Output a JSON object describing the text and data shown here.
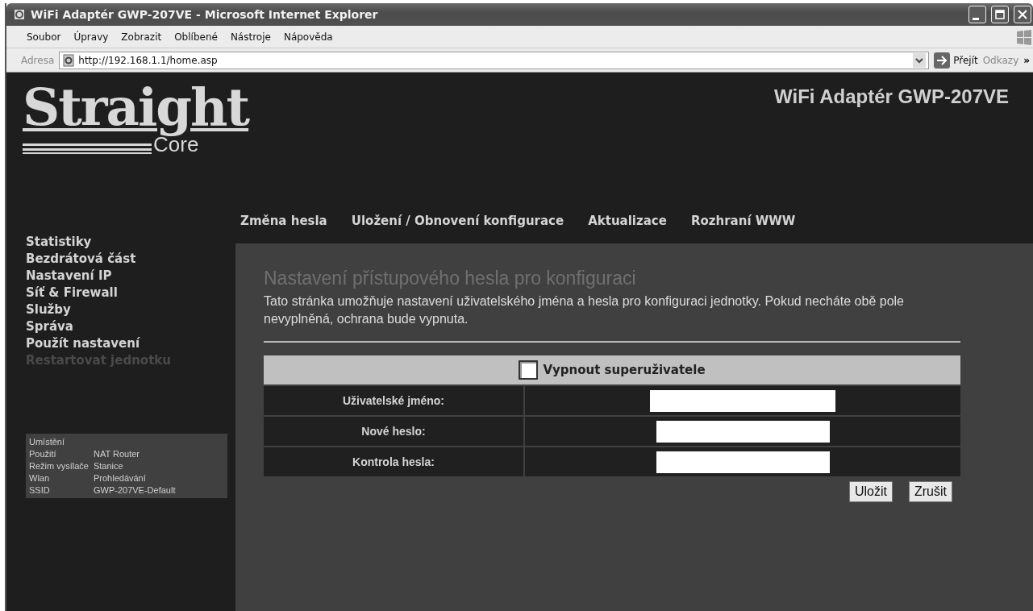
{
  "window": {
    "title": "WiFi Adaptér GWP-207VE - Microsoft Internet Explorer"
  },
  "menu": [
    "Soubor",
    "Úpravy",
    "Zobrazit",
    "Oblíbené",
    "Nástroje",
    "Nápověda"
  ],
  "address_bar": {
    "label": "Adresa",
    "url": "http://192.168.1.1/home.asp",
    "go": "Přejít",
    "links": "Odkazy",
    "more": "»"
  },
  "logo": {
    "word": "Straight",
    "sub": "Core"
  },
  "device_title": "WiFi Adaptér GWP-207VE",
  "top_nav": [
    "Změna hesla",
    "Uložení / Obnovení konfigurace",
    "Aktualizace",
    "Rozhraní WWW"
  ],
  "side_nav": [
    {
      "label": "Statistiky",
      "disabled": false
    },
    {
      "label": "Bezdrátová část",
      "disabled": false
    },
    {
      "label": "Nastavení IP",
      "disabled": false
    },
    {
      "label": "Síť & Firewall",
      "disabled": false
    },
    {
      "label": "Služby",
      "disabled": false
    },
    {
      "label": "Správa",
      "disabled": false
    },
    {
      "label": "Použít nastavení",
      "disabled": false
    },
    {
      "label": "Restartovat jednotku",
      "disabled": true
    }
  ],
  "info": [
    {
      "label": "Umístění"
    },
    {
      "label": "Použití",
      "value": "NAT Router"
    },
    {
      "label": "Režim vysílače",
      "value": "Stanice"
    },
    {
      "label": "Wlan",
      "value": "Prohledávání"
    },
    {
      "label": "SSID",
      "value": "GWP-207VE-Default"
    }
  ],
  "heading": "Nastavení přístupového hesla pro konfiguraci",
  "description": "Tato stránka umožňuje nastavení uživatelského jména a hesla pro konfiguraci jednotky. Pokud necháte obě pole nevyplněná, ochrana bude vypnuta.",
  "disable_superuser": {
    "label": "Vypnout superuživatele",
    "checked": false
  },
  "fields": [
    {
      "label": "Uživatelské jméno:"
    },
    {
      "label": "Nové heslo:"
    },
    {
      "label": "Kontrola hesla:"
    }
  ],
  "buttons": [
    "Uložit",
    "Zrušit"
  ]
}
